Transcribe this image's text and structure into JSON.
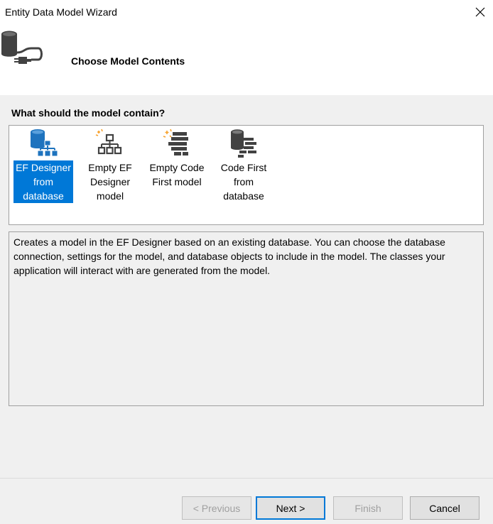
{
  "window": {
    "title": "Entity Data Model Wizard"
  },
  "header": {
    "heading": "Choose Model Contents"
  },
  "question": "What should the model contain?",
  "items": [
    {
      "lines": [
        "EF Designer",
        "from",
        "database"
      ],
      "icon": "ef-designer-from-database-icon",
      "selected": true
    },
    {
      "lines": [
        "Empty EF",
        "Designer",
        "model"
      ],
      "icon": "empty-ef-designer-model-icon",
      "selected": false
    },
    {
      "lines": [
        "Empty Code",
        "First model"
      ],
      "icon": "empty-code-first-model-icon",
      "selected": false
    },
    {
      "lines": [
        "Code First",
        "from",
        "database"
      ],
      "icon": "code-first-from-database-icon",
      "selected": false
    }
  ],
  "description": "Creates a model in the EF Designer based on an existing database. You can choose the database connection, settings for the model, and database objects to include in the model. The classes your application will interact with are generated from the model.",
  "buttons": {
    "previous": "< Previous",
    "next": "Next >",
    "finish": "Finish",
    "cancel": "Cancel"
  },
  "colors": {
    "selection": "#0078d7",
    "icon_blue": "#1e73be",
    "icon_dark": "#424242",
    "sparkle": "#f7a12b"
  }
}
